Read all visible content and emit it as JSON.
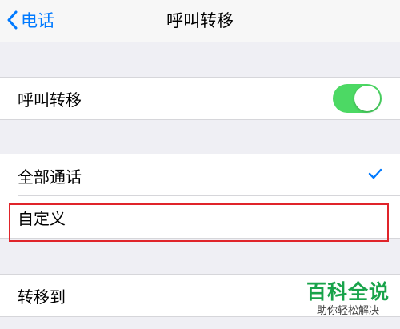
{
  "nav": {
    "back_label": "电话",
    "title": "呼叫转移"
  },
  "forward_section": {
    "label": "呼叫转移",
    "toggle_on": true
  },
  "scope_section": {
    "items": [
      {
        "label": "全部通话",
        "selected": true
      },
      {
        "label": "自定义",
        "selected": false
      }
    ]
  },
  "target_section": {
    "label": "转移到"
  },
  "watermark": {
    "title": "百科全说",
    "subtitle": "助你轻松解决"
  },
  "colors": {
    "accent": "#007aff",
    "toggle_on": "#4cd964",
    "highlight": "#e0242a",
    "watermark": "#18a34a"
  },
  "icons": {
    "back": "chevron-left-icon",
    "check": "checkmark-icon"
  }
}
